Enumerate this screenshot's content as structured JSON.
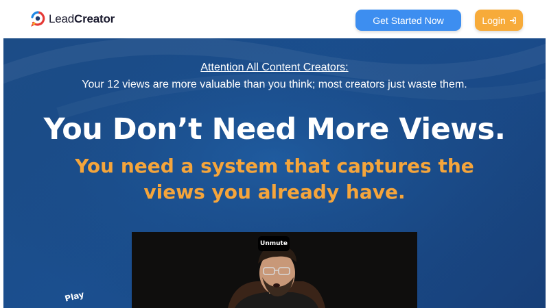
{
  "header": {
    "logo": {
      "text_regular": "Lead",
      "text_bold": "Creator"
    },
    "get_started_label": "Get Started Now",
    "login_label": "Login"
  },
  "hero": {
    "attention": "Attention All Content Creators:",
    "subtext": "Your 12 views are more valuable than you think; most creators just waste them.",
    "headline": "You Don’t Need More Views.",
    "subheadline": "You need a system that captures the views you already have.",
    "play_label": "Play"
  },
  "video": {
    "unmute_label": "Unmute"
  },
  "colors": {
    "primary_blue": "#3d8ef0",
    "accent_orange": "#f7ab3a",
    "hero_bg": "#1b4f8f",
    "subheadline": "#f5a53b"
  },
  "icons": [
    "leadcreator-logo-icon",
    "login-arrow-icon"
  ]
}
